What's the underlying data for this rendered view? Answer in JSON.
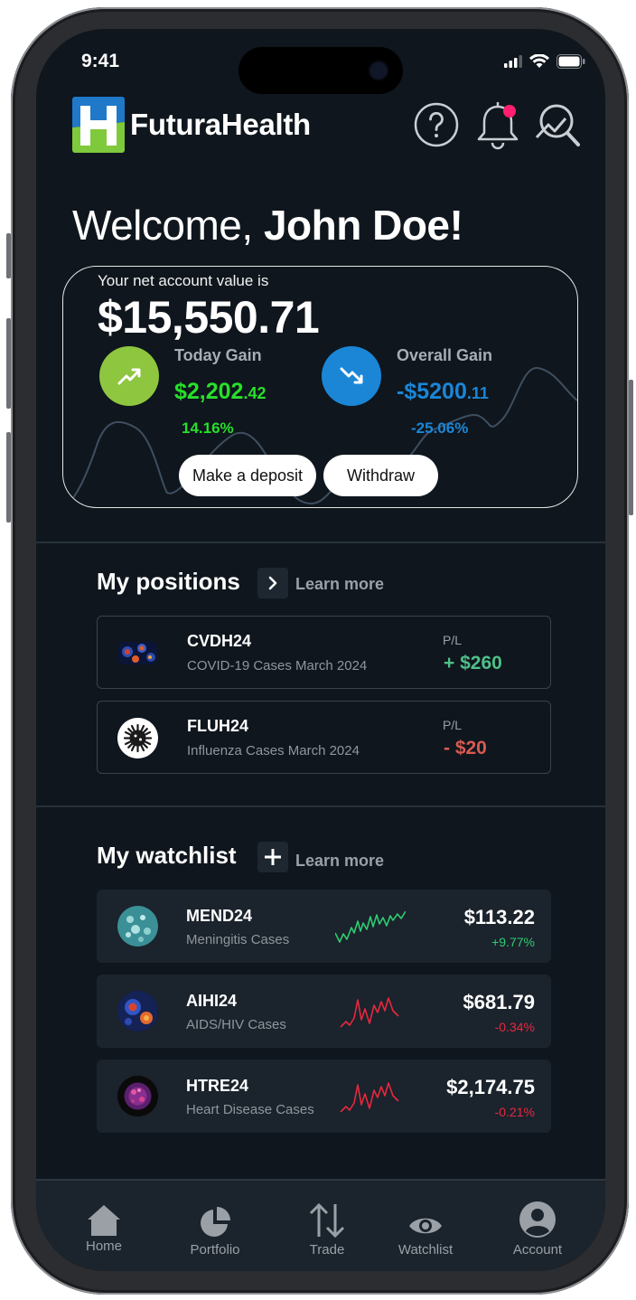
{
  "status": {
    "time": "9:41"
  },
  "header": {
    "brand": "FuturaHealth"
  },
  "welcome": {
    "greeting": "Welcome,",
    "name": "John Doe!"
  },
  "account": {
    "label": "Your net account value is",
    "value": "$15,550.71",
    "today_gain": {
      "title": "Today Gain",
      "amount": "$2,202",
      "cents": ".42",
      "percent": "14.16%",
      "color": "#27e02a"
    },
    "overall_gain": {
      "title": "Overall Gain",
      "amount": "-$5200",
      "cents": ".11",
      "percent": "-25.06%",
      "color": "#1b86d6"
    },
    "deposit_label": "Make a deposit",
    "withdraw_label": "Withdraw"
  },
  "positions": {
    "title": "My positions",
    "learn_more": "Learn more",
    "items": [
      {
        "ticker": "CVDH24",
        "desc": "COVID-19 Cases March 2024",
        "pl_label": "P/L",
        "pl": "+ $260",
        "pl_color": "#4fbf88"
      },
      {
        "ticker": "FLUH24",
        "desc": "Influenza Cases March 2024",
        "pl_label": "P/L",
        "pl": "- $20",
        "pl_color": "#d85a52"
      }
    ]
  },
  "watchlist": {
    "title": "My watchlist",
    "learn_more": "Learn more",
    "items": [
      {
        "ticker": "MEND24",
        "desc": "Meningitis Cases",
        "price": "$113.22",
        "change": "+9.77%",
        "trend": "up"
      },
      {
        "ticker": "AIHI24",
        "desc": "AIDS/HIV Cases",
        "price": "$681.79",
        "change": "-0.34%",
        "trend": "down"
      },
      {
        "ticker": "HTRE24",
        "desc": "Heart Disease Cases",
        "price": "$2,174.75",
        "change": "-0.21%",
        "trend": "down"
      }
    ]
  },
  "tabs": [
    {
      "label": "Home",
      "icon": "home-icon"
    },
    {
      "label": "Portfolio",
      "icon": "pie-chart-icon"
    },
    {
      "label": "Trade",
      "icon": "arrows-up-down-icon"
    },
    {
      "label": "Watchlist",
      "icon": "eye-icon"
    },
    {
      "label": "Account",
      "icon": "user-circle-icon"
    }
  ],
  "colors": {
    "background": "#0f161d",
    "card": "#1b232c",
    "up": "#2ecc71",
    "down": "#e8283f"
  }
}
